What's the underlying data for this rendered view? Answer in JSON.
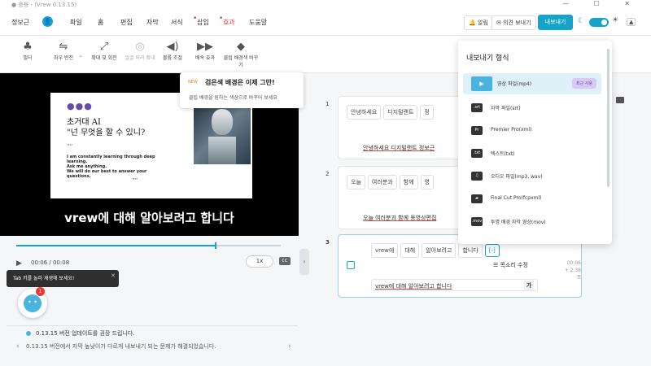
{
  "window": {
    "title": "● 응용 - (Vrew 0.13.15)",
    "controls": "— ☐ ✕"
  },
  "menu": {
    "items": [
      {
        "label": "정보근",
        "red": false,
        "active": false
      },
      {
        "label": "파일",
        "red": false,
        "active": false
      },
      {
        "label": "홈",
        "red": false,
        "active": false
      },
      {
        "label": "편집",
        "red": false,
        "active": false
      },
      {
        "label": "자막",
        "red": false,
        "active": false
      },
      {
        "label": "서식",
        "red": false,
        "active": false
      },
      {
        "label": "삽입",
        "red": true,
        "active": false
      },
      {
        "label": "효과",
        "red": true,
        "active": true
      },
      {
        "label": "도움말",
        "red": false,
        "active": false
      }
    ],
    "user_icon": "user-icon",
    "alarm": "🔔 알림",
    "feedback": "✉ 의견 보내기",
    "export": "내보내기",
    "theme_icon": "☀",
    "collapse_icon": "▲"
  },
  "toolbar": {
    "tools": [
      {
        "label": "필터",
        "icon": "♣",
        "dim": false
      },
      {
        "label": "좌우 반전",
        "icon": "⇋",
        "dim": false
      },
      {
        "label": "확대 및 회전",
        "icon": "⤢",
        "dim": false
      },
      {
        "label": "얼굴 따라 확대",
        "icon": "◎",
        "dim": true
      },
      {
        "label": "볼륨 조절",
        "icon": "◀)",
        "dim": false
      },
      {
        "label": "배속 효과",
        "icon": "▶▶",
        "dim": false
      },
      {
        "label": "클립 배경색 바꾸기",
        "icon": "◆",
        "dim": false
      }
    ]
  },
  "slide": {
    "dots": "●●●",
    "title": "초거대 AI\n\"넌 무엇을 할 수 있니?",
    "quote_open": "““",
    "body": "I am constantly learning through deep learning.\nAsk me anything.\nWe will do our best to answer your questions.",
    "quote_close": "””"
  },
  "caption": "vrew에 대해 알아보려고 합니다",
  "player": {
    "progress": 0.75,
    "timecode": "00:06 / 00:08",
    "speed": "1x",
    "subtitle_icon": "CC"
  },
  "tooltip": {
    "text": "Tab 키를 눌러 재생해 보세요!",
    "close": "✕"
  },
  "bot": {
    "badge": "1",
    "face": "• •"
  },
  "notice": {
    "title": "0.13.15 버전 업데이트를 권장 드립니다.",
    "desc": "0.13.15 버전에서 자막 높낮이가 다르게 내보내기 되는 문제가 해결되었습니다.",
    "prev": "‹",
    "next": "›"
  },
  "collapse": "›",
  "newtip": {
    "badge": "NEW",
    "title": "검은색 배경은 이제 그만!",
    "desc": "클립 배경을 원하는 색상으로 바꾸어 보세요"
  },
  "clips": [
    {
      "num": "1",
      "chips": [
        "안녕하세요",
        "디지털랜트",
        "정"
      ],
      "line": "안녕하세요 디지털랜트 정보근"
    },
    {
      "num": "2",
      "chips": [
        "오늘",
        "여러분과",
        "함께",
        "영"
      ],
      "line": "오늘 여러분과 함께 동영상편집"
    },
    {
      "num": "3",
      "chips": [
        "vrew에",
        "대해",
        "알아보려고",
        "합니다",
        "[-]"
      ],
      "voice": "☰ 목소리 수정",
      "time1": "00:06",
      "time2": "+ 2.38초",
      "input": "vrew에 대해 알아보려고 합니다",
      "ga": "가"
    }
  ],
  "export_panel": {
    "title": "내보내기 형식",
    "items": [
      {
        "icon": "▶",
        "label": "영상 파일(mp4)",
        "tag": "최근 사용"
      },
      {
        "icon": ".srt",
        "label": "자막 파일(srt)",
        "tag": ""
      },
      {
        "icon": "Pr",
        "label": "Premier Pro(xml)",
        "tag": ""
      },
      {
        "icon": ".txt",
        "label": "텍스트(txt)",
        "tag": ""
      },
      {
        "icon": "♫",
        "label": "오디오 파일(mp3, wav)",
        "tag": ""
      },
      {
        "icon": "▰",
        "label": "Final Cut Pro(fcpxml)",
        "tag": ""
      },
      {
        "icon": ".mov",
        "label": "투명 배경 자막 영상(mov)",
        "tag": ""
      }
    ]
  },
  "colors": {
    "accent": "#15a4c8",
    "red": "#e53935"
  }
}
